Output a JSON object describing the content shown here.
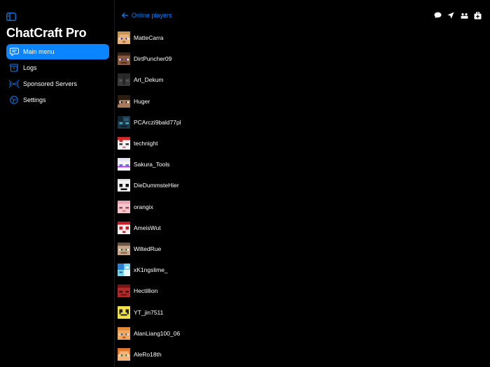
{
  "app": {
    "title": "ChatCraft Pro"
  },
  "sidebar": {
    "items": [
      {
        "label": "Main menu",
        "icon": "chat-bubble-icon",
        "active": true
      },
      {
        "label": "Logs",
        "icon": "archive-box-icon",
        "active": false
      },
      {
        "label": "Sponsored Servers",
        "icon": "broadcast-icon",
        "active": false
      },
      {
        "label": "Settings",
        "icon": "settings-circle-icon",
        "active": false
      }
    ]
  },
  "header": {
    "back_label": "Online players",
    "toolbar_icons": [
      "chat-icon",
      "location-arrow-icon",
      "people-icon",
      "medkit-icon"
    ]
  },
  "colors": {
    "accent": "#0a84ff",
    "background": "#000000",
    "text": "#ffffff"
  },
  "players": [
    {
      "name": "MatteCarra",
      "skin": "tan-hair-face"
    },
    {
      "name": "DirtPuncher09",
      "skin": "brown-face"
    },
    {
      "name": "Art_Dekum",
      "skin": "dark-grey-face"
    },
    {
      "name": "Huger",
      "skin": "dark-hair-face"
    },
    {
      "name": "PCArczi9bald77pl",
      "skin": "teal-dark-face"
    },
    {
      "name": "technight",
      "skin": "red-white-face"
    },
    {
      "name": "Sakura_Tools",
      "skin": "white-blue-face"
    },
    {
      "name": "DieDummsteHier",
      "skin": "white-black-face"
    },
    {
      "name": "orangix",
      "skin": "pink-face"
    },
    {
      "name": "AmeisWut",
      "skin": "white-red-face"
    },
    {
      "name": "WiltedRue",
      "skin": "beige-face"
    },
    {
      "name": "xK1ngslime_",
      "skin": "cyan-face"
    },
    {
      "name": "Hectillion",
      "skin": "red-face"
    },
    {
      "name": "YT_jin7511",
      "skin": "yellow-face"
    },
    {
      "name": "AlanLiang100_06",
      "skin": "orange-face"
    },
    {
      "name": "AleRo18th",
      "skin": "orange-hair-face"
    }
  ]
}
